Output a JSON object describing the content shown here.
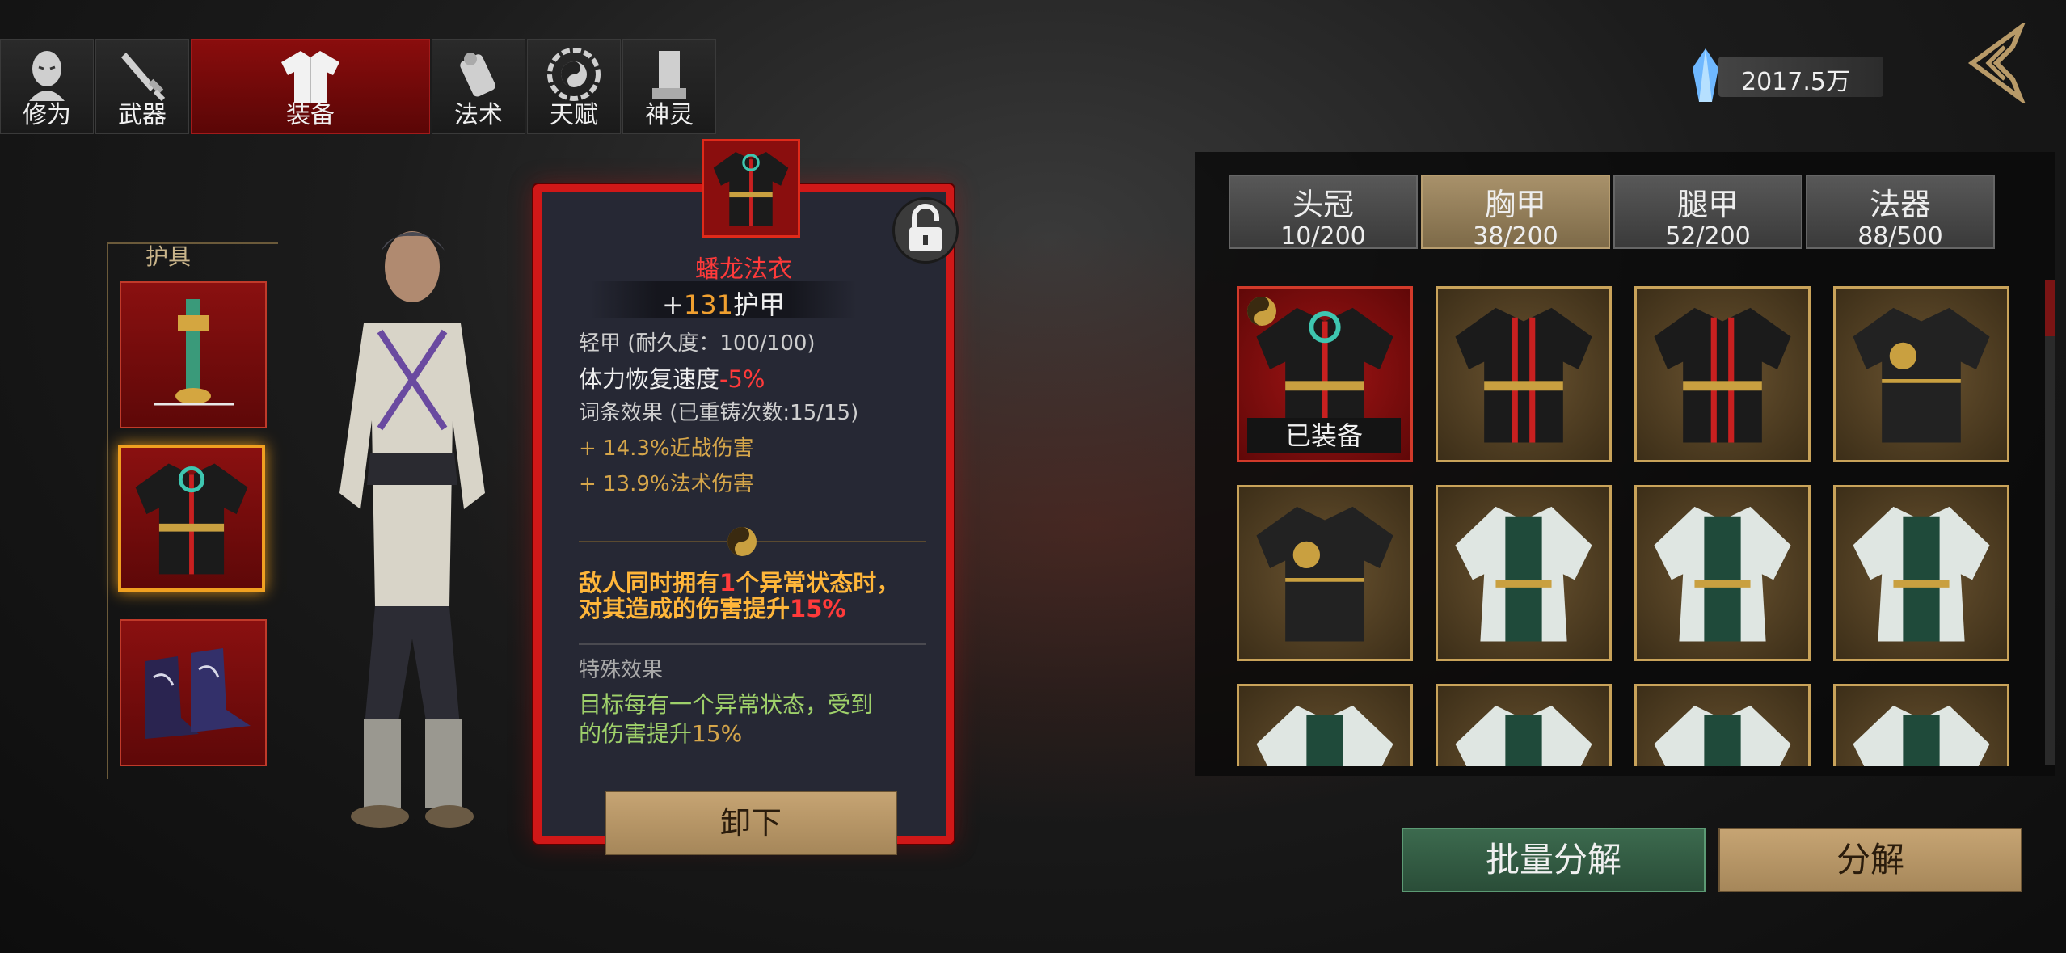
{
  "top_tabs": [
    {
      "label": "修为",
      "icon": "monk-head-icon"
    },
    {
      "label": "武器",
      "icon": "sword-icon"
    },
    {
      "label": "装备",
      "icon": "robe-icon",
      "active": true
    },
    {
      "label": "法术",
      "icon": "scroll-icon"
    },
    {
      "label": "天赋",
      "icon": "bagua-icon"
    },
    {
      "label": "神灵",
      "icon": "tablet-icon"
    }
  ],
  "currency": {
    "value": "2017.5万",
    "icon": "crystal-icon"
  },
  "gear": {
    "label": "护具",
    "slots": [
      {
        "name": "jade-pendant",
        "selected": false
      },
      {
        "name": "robe",
        "selected": true
      },
      {
        "name": "boots",
        "selected": false
      }
    ]
  },
  "detail": {
    "name": "蟠龙法衣",
    "armor_prefix": "+",
    "armor_value": "131",
    "armor_suffix": "护甲",
    "type_line": "轻甲  (耐久度：100/100)",
    "stamina_label": "体力恢复速度",
    "stamina_value": "-5%",
    "affix_label": "词条效果  (已重铸次数:15/15)",
    "affixes": [
      "+ 14.3%近战伤害",
      "+ 13.9%法术伤害"
    ],
    "set_effect_line1_a": "敌人同时拥有",
    "set_effect_line1_b": "1",
    "set_effect_line1_c": "个异常状态时，",
    "set_effect_line2_a": "对其造成的伤害提升",
    "set_effect_line2_b": "15%",
    "special_label": "特殊效果",
    "special_line1": "目标每有一个异常状态，受到",
    "special_line2_a": "的伤害提升",
    "special_line2_b": "15%",
    "unequip_label": "卸下"
  },
  "categories": [
    {
      "name": "头冠",
      "count": "10/200",
      "active": false
    },
    {
      "name": "胸甲",
      "count": "38/200",
      "active": true
    },
    {
      "name": "腿甲",
      "count": "52/200",
      "active": false
    },
    {
      "name": "法器",
      "count": "88/500",
      "active": false
    }
  ],
  "inventory": {
    "equipped_badge": "已装备",
    "items": [
      {
        "style": "black-red",
        "equipped": true
      },
      {
        "style": "black-red",
        "equipped": false
      },
      {
        "style": "black-red",
        "equipped": false
      },
      {
        "style": "black-gold",
        "equipped": false
      },
      {
        "style": "black-gold",
        "equipped": false
      },
      {
        "style": "green-white",
        "equipped": false
      },
      {
        "style": "green-white",
        "equipped": false
      },
      {
        "style": "green-white",
        "equipped": false
      },
      {
        "style": "green-white",
        "equipped": false
      },
      {
        "style": "green-white",
        "equipped": false
      },
      {
        "style": "green-white",
        "equipped": false
      },
      {
        "style": "green-white",
        "equipped": false
      }
    ]
  },
  "buttons": {
    "batch": "批量分解",
    "salvage": "分解"
  },
  "colors": {
    "accent_red": "#d01818",
    "gold": "#c9a35a",
    "green_button": "#3c6a4e"
  }
}
